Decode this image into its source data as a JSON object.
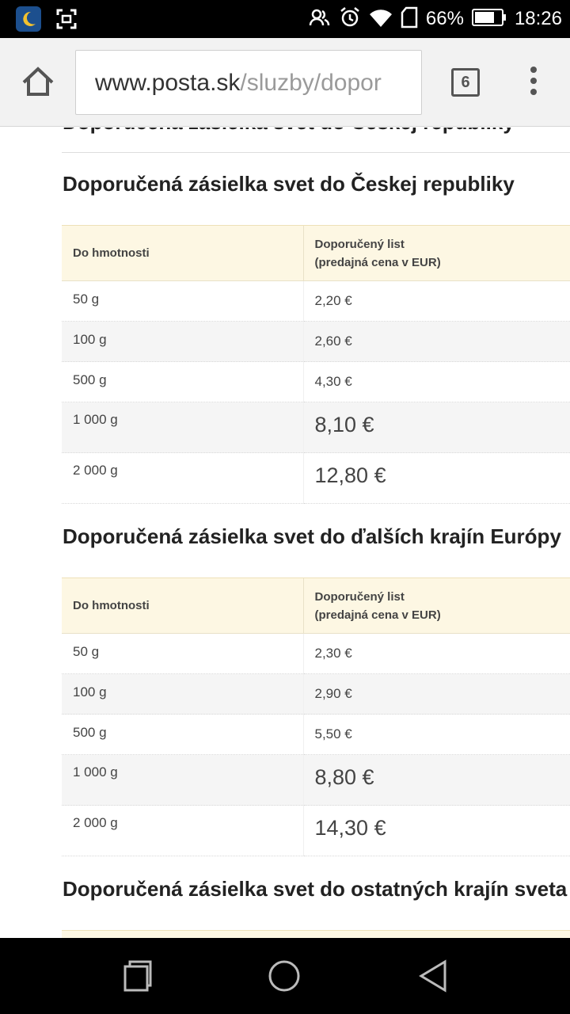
{
  "status_bar": {
    "battery_percent": "66%",
    "time": "18:26",
    "icons": [
      "moon-app-icon",
      "screenshot-icon",
      "contacts-icon",
      "alarm-icon",
      "wifi-icon",
      "sim-icon",
      "battery-icon"
    ]
  },
  "browser": {
    "url_host": "www.posta.sk",
    "url_path": "/sluzby/dopor",
    "tab_count": "6",
    "icons": [
      "home-icon",
      "tabs-icon",
      "overflow-menu-icon"
    ]
  },
  "page": {
    "cut_heading": "Doporučená zásielka svet do Českej republiky",
    "sections": [
      {
        "title": "Doporučená zásielka svet do Českej republiky",
        "header_weight": "Do hmotnosti",
        "header_price_line1": "Doporučený list",
        "header_price_line2": "(predajná cena v EUR)",
        "rows": [
          {
            "weight": "50 g",
            "price": "2,20 €"
          },
          {
            "weight": "100 g",
            "price": "2,60 €"
          },
          {
            "weight": "500 g",
            "price": "4,30 €"
          },
          {
            "weight": "1 000 g",
            "price": "8,10 €"
          },
          {
            "weight": "2 000 g",
            "price": "12,80 €"
          }
        ]
      },
      {
        "title": "Doporučená zásielka svet do ďalších krajín Európy",
        "header_weight": "Do hmotnosti",
        "header_price_line1": "Doporučený list",
        "header_price_line2": "(predajná cena v EUR)",
        "rows": [
          {
            "weight": "50 g",
            "price": "2,30 €"
          },
          {
            "weight": "100 g",
            "price": "2,90 €"
          },
          {
            "weight": "500 g",
            "price": "5,50 €"
          },
          {
            "weight": "1 000 g",
            "price": "8,80 €"
          },
          {
            "weight": "2 000 g",
            "price": "14,30 €"
          }
        ]
      },
      {
        "title": "Doporučená zásielka svet do ostatných krajín sveta"
      }
    ]
  },
  "navbar": {
    "icons": [
      "recents-icon",
      "home-circle-icon",
      "back-icon"
    ]
  }
}
